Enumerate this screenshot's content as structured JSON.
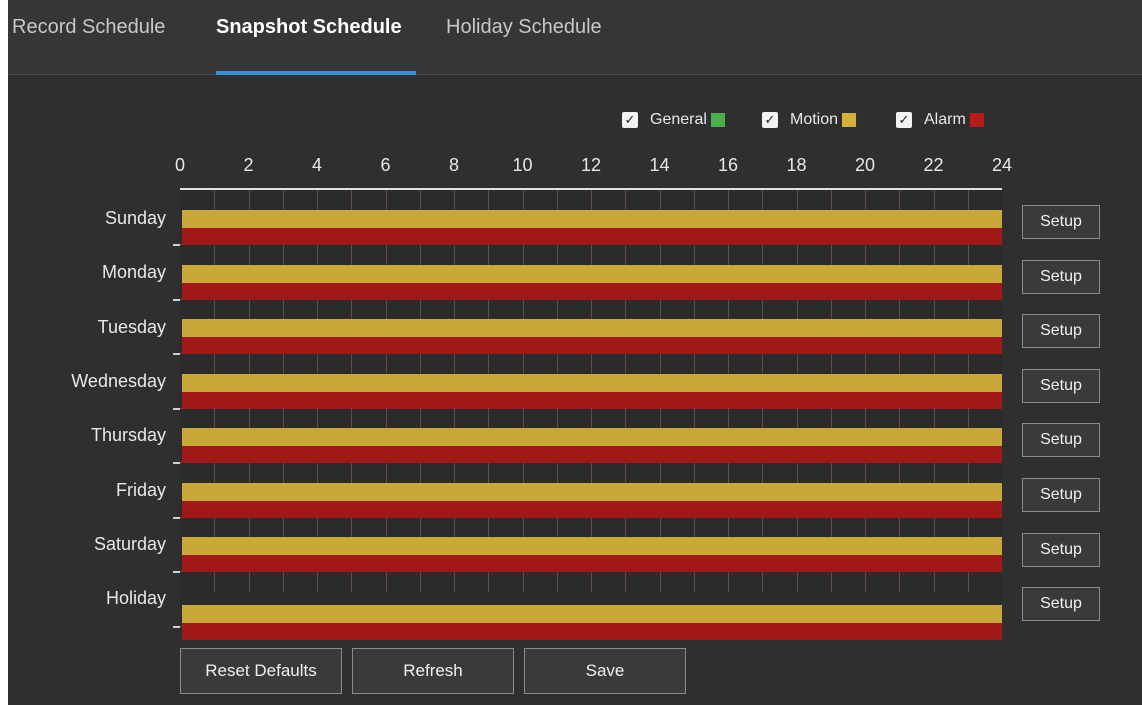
{
  "tabs": [
    {
      "label": "Record Schedule",
      "active": false
    },
    {
      "label": "Snapshot Schedule",
      "active": true
    },
    {
      "label": "Holiday Schedule",
      "active": false
    }
  ],
  "legend": [
    {
      "label": "General",
      "checked": true,
      "color": "#4caf50"
    },
    {
      "label": "Motion",
      "checked": true,
      "color": "#d4b03c"
    },
    {
      "label": "Alarm",
      "checked": true,
      "color": "#b71c1c"
    }
  ],
  "axis": {
    "ticks": [
      "0",
      "2",
      "4",
      "6",
      "8",
      "10",
      "12",
      "14",
      "16",
      "18",
      "20",
      "22",
      "24"
    ]
  },
  "colors": {
    "accent": "#2f93d6",
    "motion": "#c8a838",
    "alarm": "#a01818"
  },
  "days": [
    {
      "label": "Sunday",
      "setup": "Setup"
    },
    {
      "label": "Monday",
      "setup": "Setup"
    },
    {
      "label": "Tuesday",
      "setup": "Setup"
    },
    {
      "label": "Wednesday",
      "setup": "Setup"
    },
    {
      "label": "Thursday",
      "setup": "Setup"
    },
    {
      "label": "Friday",
      "setup": "Setup"
    },
    {
      "label": "Saturday",
      "setup": "Setup"
    },
    {
      "label": "Holiday",
      "setup": "Setup"
    }
  ],
  "buttons": {
    "reset": "Reset Defaults",
    "refresh": "Refresh",
    "save": "Save"
  }
}
